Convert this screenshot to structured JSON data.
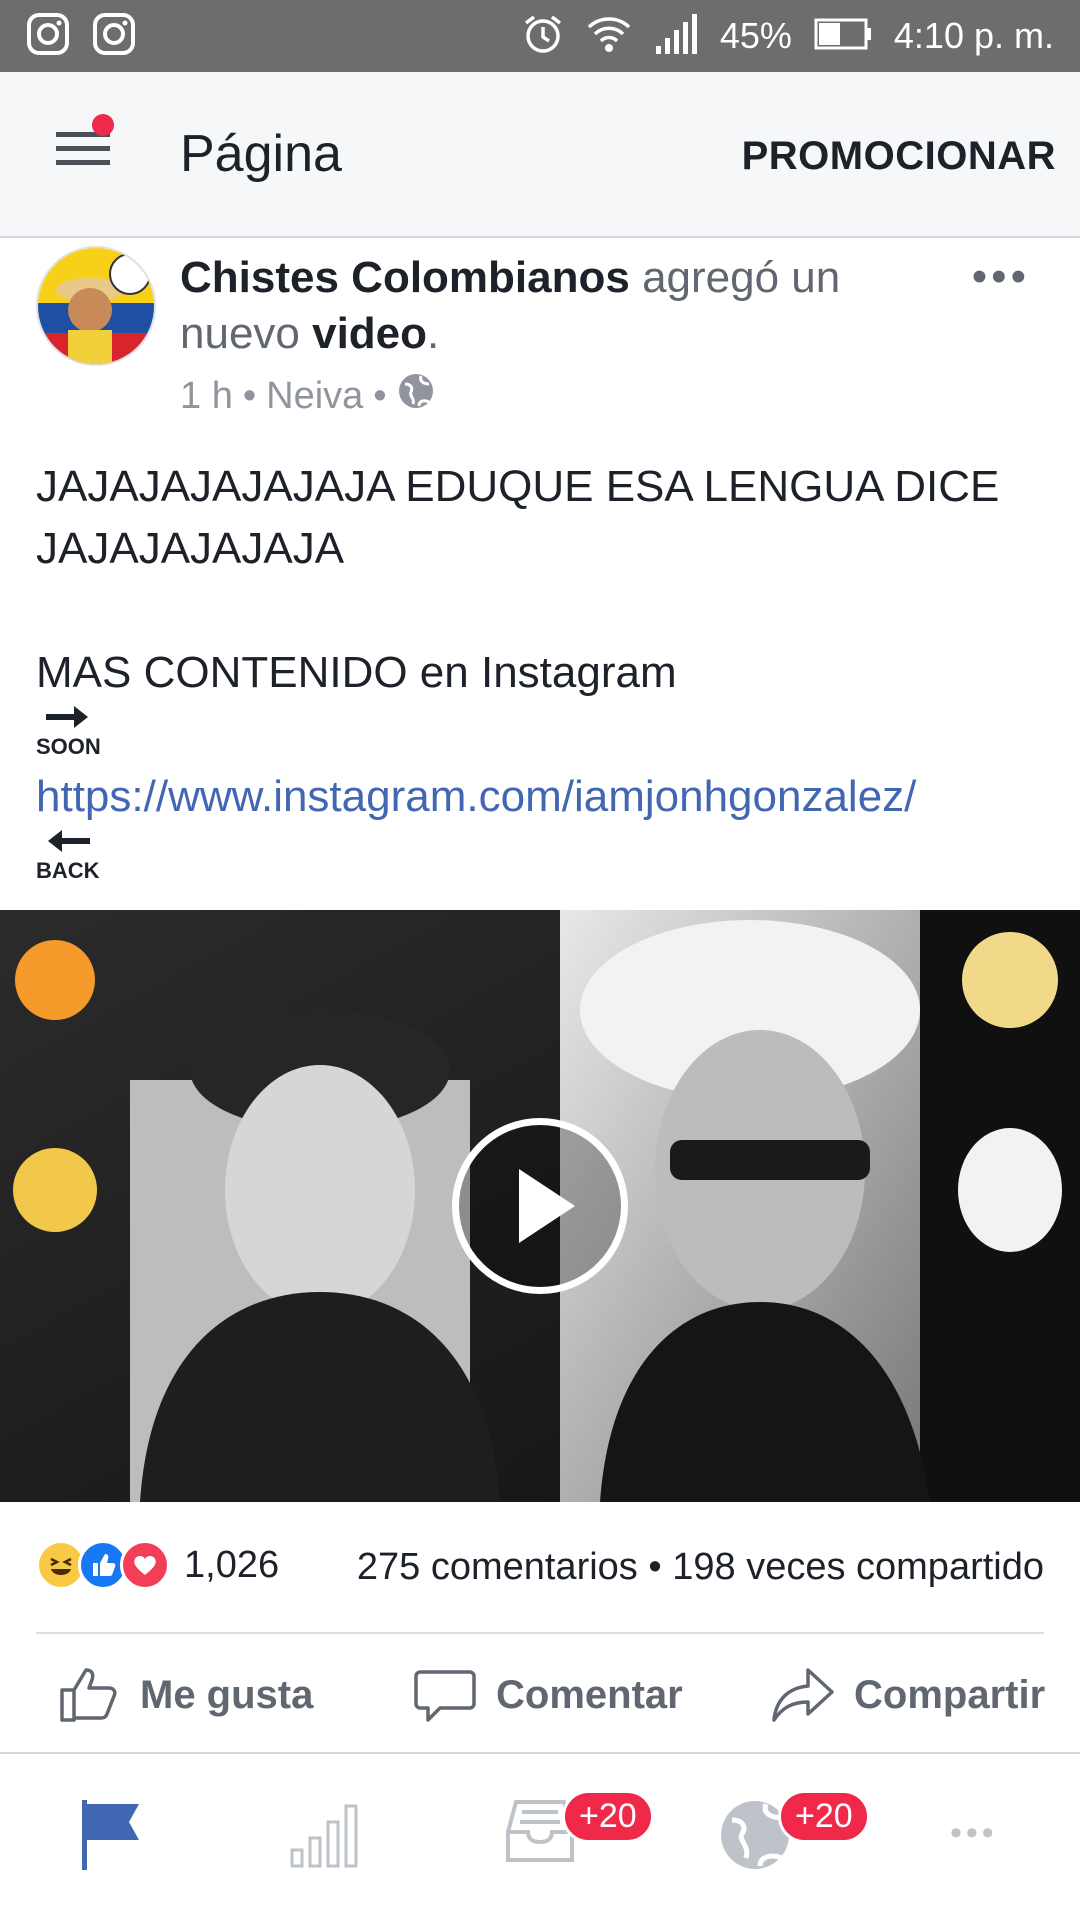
{
  "status_bar": {
    "battery": "45%",
    "time": "4:10 p. m."
  },
  "app_bar": {
    "title": "Página",
    "promote_label": "PROMOCIONAR"
  },
  "post": {
    "author": "Chistes Colombianos",
    "action_text": " agregó un nuevo ",
    "object": "video",
    "period": ".",
    "time": "1 h",
    "location": "Neiva",
    "sep": "•",
    "text_line1": "JAJAJAJAJAJAJA EDUQUE ESA LENGUA DICE JAJAJAJAJAJA",
    "text_line2": "MAS CONTENIDO en Instagram",
    "soon_label": "SOON",
    "link": "https://www.instagram.com/iamjonhgonzalez/",
    "back_label": "BACK"
  },
  "engagement": {
    "reaction_count": "1,026",
    "comments": "275 comentarios",
    "dot": "•",
    "shares": "198 veces compartido"
  },
  "actions": {
    "like": "Me gusta",
    "comment": "Comentar",
    "share": "Compartir"
  },
  "bottom_nav": {
    "inbox_badge": "+20",
    "notifications_badge": "+20",
    "more": "•••"
  },
  "colors": {
    "accent": "#4267b2",
    "badge": "#f02849",
    "status_bar": "#6d6d6d"
  }
}
